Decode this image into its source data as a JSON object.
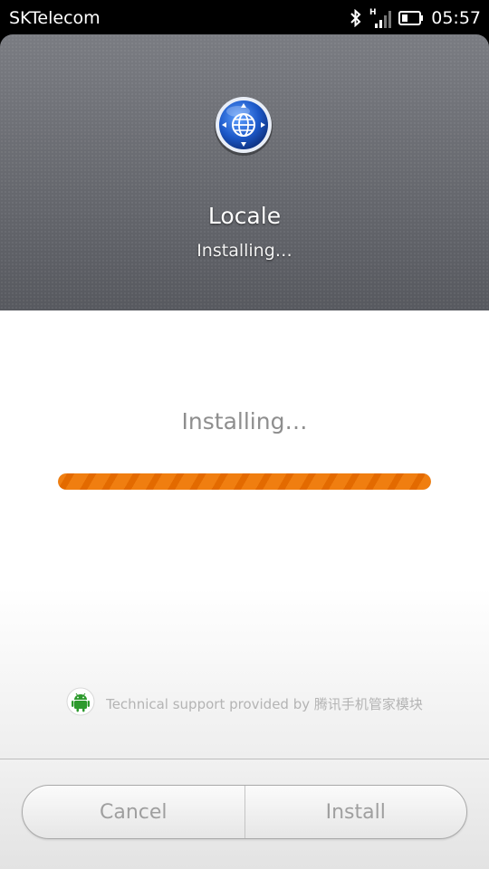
{
  "status_bar": {
    "carrier": "SKTelecom",
    "time": "05:57",
    "network_type": "H",
    "icons": [
      "bluetooth-icon",
      "signal-icon",
      "battery-icon"
    ]
  },
  "header": {
    "app_icon": "globe-compass-icon",
    "app_name": "Locale",
    "status": "Installing…"
  },
  "main": {
    "progress_label": "Installing…",
    "progress_fraction": 1.0,
    "support_text": "Technical support provided by 腾讯手机管家模块",
    "support_icon": "android-icon"
  },
  "footer": {
    "cancel_label": "Cancel",
    "install_label": "Install"
  },
  "colors": {
    "progress": "#f07e10",
    "header_bg": "#5d5f66",
    "android_green": "#2e9a2e"
  }
}
